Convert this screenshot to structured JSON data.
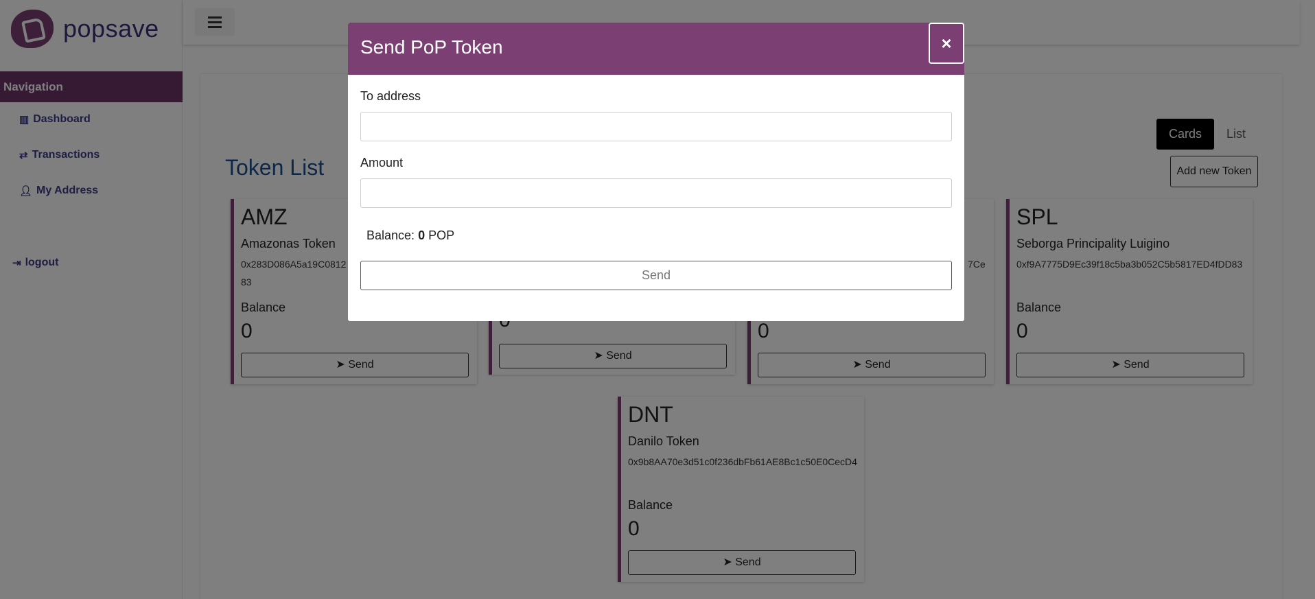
{
  "app": {
    "brand": "popsave"
  },
  "sidebar": {
    "header": "Navigation",
    "items": [
      {
        "label": "Dashboard",
        "icon": "columns-icon"
      },
      {
        "label": "Transactions",
        "icon": "exchange-icon"
      },
      {
        "label": "My Address",
        "icon": "user-icon"
      }
    ],
    "logout": "logout"
  },
  "main": {
    "title": "Token List",
    "view_toggle": {
      "cards": "Cards",
      "list": "List"
    },
    "add_token": "Add new Token",
    "tokens": [
      {
        "symbol": "AMZ",
        "name": "Amazonas Token",
        "address": "0x283D086A5a19C0812",
        "address_end": "83",
        "balance_label": "Balance",
        "balance": "0",
        "send": "Send"
      },
      {
        "symbol": "",
        "name": "",
        "address": "",
        "balance_label": "",
        "balance": "0",
        "send": "Send"
      },
      {
        "symbol": "",
        "name": "",
        "address": "7Ce",
        "balance_label": "",
        "balance": "0",
        "send": "Send"
      },
      {
        "symbol": "SPL",
        "name": "Seborga Principality Luigino",
        "address": "0xf9A7775D9Ec39f18c5ba3b052C5b5817ED4fDD83",
        "balance_label": "Balance",
        "balance": "0",
        "send": "Send"
      },
      {
        "symbol": "DNT",
        "name": "Danilo Token",
        "address": "0x9b8AA70e3d51c0f236dbFb61AE8Bc1c50E0CecD4",
        "balance_label": "Balance",
        "balance": "0",
        "send": "Send"
      }
    ]
  },
  "modal": {
    "title": "Send PoP Token",
    "close": "×",
    "to_label": "To address",
    "to_value": "",
    "amount_label": "Amount",
    "amount_value": "",
    "balance_prefix": "Balance:",
    "balance_value": "0",
    "balance_unit": "POP",
    "send": "Send"
  },
  "colors": {
    "brand": "#7b3f74",
    "title": "#1f4f8c",
    "nav_text": "#3b3b8a"
  }
}
